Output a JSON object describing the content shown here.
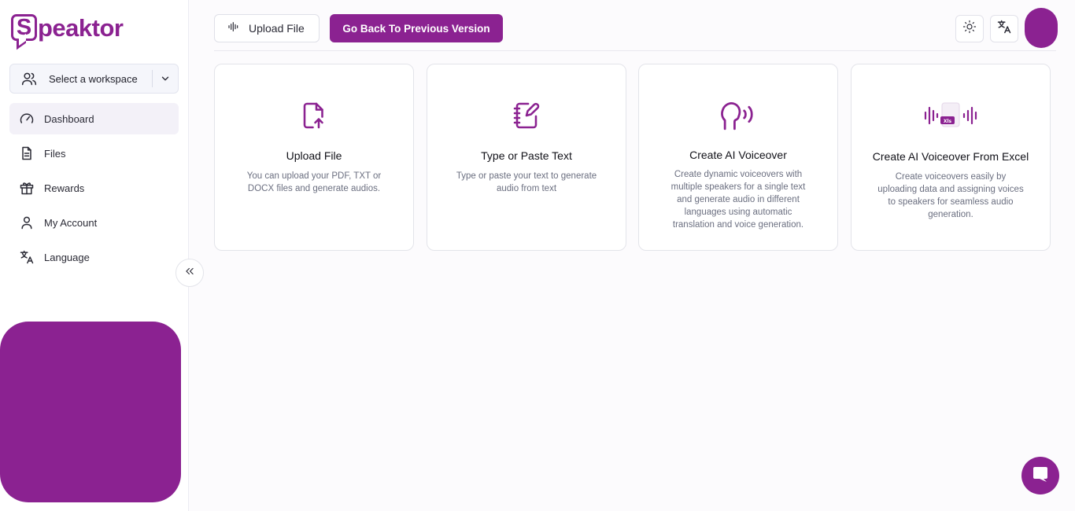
{
  "brand": {
    "name": "Speaktor",
    "accent": "#8b2291"
  },
  "sidebar": {
    "workspace": {
      "label": "Select a workspace",
      "icon": "users-icon",
      "chevron": "chevron-down-icon"
    },
    "items": [
      {
        "label": "Dashboard",
        "icon": "gauge-icon",
        "active": true
      },
      {
        "label": "Files",
        "icon": "file-text-icon",
        "active": false
      },
      {
        "label": "Rewards",
        "icon": "gift-icon",
        "active": false
      },
      {
        "label": "My Account",
        "icon": "user-icon",
        "active": false
      },
      {
        "label": "Language",
        "icon": "translate-icon",
        "active": false
      }
    ],
    "collapse_icon": "double-chevron-left-icon"
  },
  "header": {
    "upload_button": {
      "label": "Upload File",
      "icon": "audio-wave-icon"
    },
    "back_button": {
      "label": "Go Back To Previous Version"
    },
    "theme_icon": "sun-icon",
    "language_icon": "translate-icon"
  },
  "cards": [
    {
      "title": "Upload File",
      "description": "You can upload your PDF, TXT or DOCX files and generate audios.",
      "icon": "file-upload-icon"
    },
    {
      "title": "Type or Paste Text",
      "description": "Type or paste your text to generate audio from text",
      "icon": "notebook-pen-icon"
    },
    {
      "title": "Create AI Voiceover",
      "description": "Create dynamic voiceovers with multiple speakers for a single text and generate audio in different languages using automatic translation and voice generation.",
      "icon": "head-voice-icon"
    },
    {
      "title": "Create AI Voiceover From Excel",
      "description": "Create voiceovers easily by uploading data and assigning voices to speakers for seamless audio generation.",
      "icon": "excel-audio-icon",
      "icon_text": "Xls"
    }
  ],
  "chat_icon": "chat-bubble-icon"
}
